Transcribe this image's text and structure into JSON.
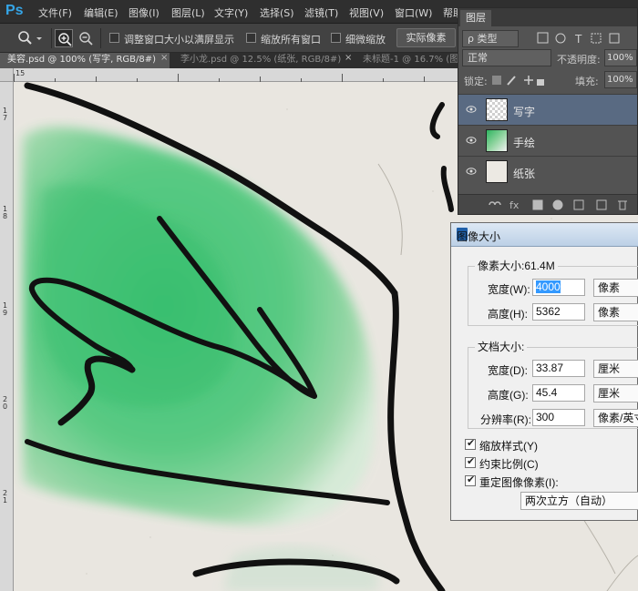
{
  "app": {
    "logo": "Ps"
  },
  "menu": [
    "文件(F)",
    "编辑(E)",
    "图像(I)",
    "图层(L)",
    "文字(Y)",
    "选择(S)",
    "滤镜(T)",
    "视图(V)",
    "窗口(W)",
    "帮助"
  ],
  "options": {
    "resize_windows_label": "调整窗口大小以满屏显示",
    "zoom_all_label": "缩放所有窗口",
    "scrubby_zoom_label": "细微缩放",
    "actual_pixels_button": "实际像素"
  },
  "tabs": [
    {
      "label": "美容.psd @ 100% (写字, RGB/8#)",
      "close": "×"
    },
    {
      "label": "李小龙.psd @ 12.5% (纸张, RGB/8#)",
      "close": "×"
    },
    {
      "label": "未标题-1 @ 16.7% (图",
      "close": ""
    }
  ],
  "rulers": {
    "top": [
      "15"
    ],
    "left": [
      "1 7",
      "1 8",
      "1 9",
      "2 0",
      "2 1"
    ]
  },
  "layers_panel": {
    "title": "图层",
    "filter_kind": "ρ 类型",
    "blend_mode": "正常",
    "opacity_label": "不透明度:",
    "opacity_value": "100%",
    "lock_label": "锁定:",
    "fill_label": "填充:",
    "fill_value": "100%",
    "layers": [
      {
        "name": "写字",
        "selected": true
      },
      {
        "name": "手绘",
        "selected": false
      },
      {
        "name": "纸张",
        "selected": false
      }
    ]
  },
  "dialog": {
    "title": "图像大小",
    "pixel_dimensions_title": "像素大小:61.4M",
    "width_label": "宽度(W):",
    "width_value": "4000",
    "width_unit": "像素",
    "height_label": "高度(H):",
    "height_value": "5362",
    "height_unit": "像素",
    "doc_size_title": "文档大小:",
    "doc_width_label": "宽度(D):",
    "doc_width_value": "33.87",
    "doc_width_unit": "厘米",
    "doc_height_label": "高度(G):",
    "doc_height_value": "45.4",
    "doc_height_unit": "厘米",
    "resolution_label": "分辨率(R):",
    "resolution_value": "300",
    "resolution_unit": "像素/英寸",
    "scale_styles_label": "缩放样式(Y)",
    "constrain_label": "约束比例(C)",
    "resample_label": "重定图像像素(I):",
    "resample_method": "两次立方（自动）"
  }
}
